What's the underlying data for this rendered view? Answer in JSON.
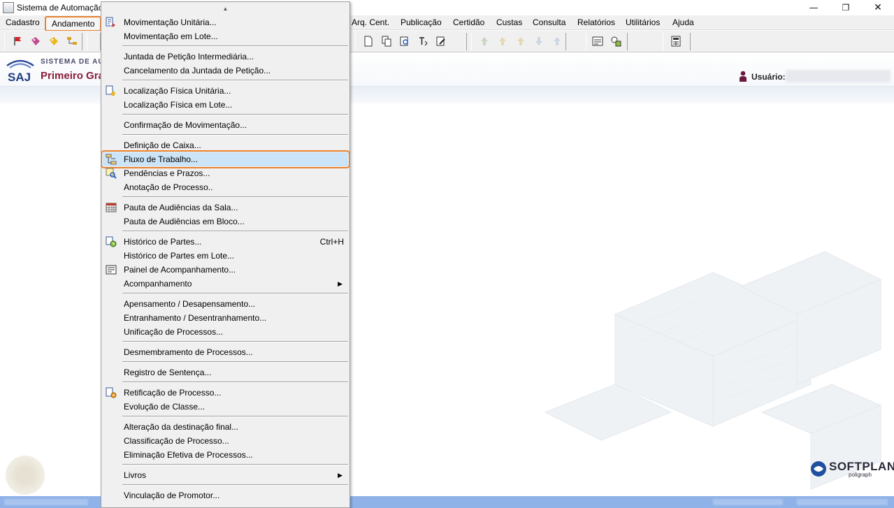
{
  "window": {
    "title": "Sistema de Automação",
    "minimize_glyph": "—",
    "maximize_glyph": "❐",
    "close_glyph": "✕"
  },
  "menubar": {
    "items": [
      "Cadastro",
      "Andamento",
      "Arq. Cent.",
      "Publicação",
      "Certidão",
      "Custas",
      "Consulta",
      "Relatórios",
      "Utilitários",
      "Ajuda"
    ],
    "active": "Andamento"
  },
  "header": {
    "logo_text": "SAJ",
    "system_name": "SISTEMA DE AUT",
    "degree": "Primeiro Gra",
    "user_label": "Usuário:"
  },
  "dropdown": {
    "scroll_up_glyph": "▲",
    "groups": [
      [
        {
          "label": "Movimentação Unitária...",
          "icon": "movement-icon"
        },
        {
          "label": "Movimentação em Lote..."
        }
      ],
      [
        {
          "label": "Juntada de Petição Intermediária..."
        },
        {
          "label": "Cancelamento da Juntada de Petição..."
        }
      ],
      [
        {
          "label": "Localização Física Unitária...",
          "icon": "location-icon"
        },
        {
          "label": "Localização Física em Lote..."
        }
      ],
      [
        {
          "label": "Confirmação de Movimentação..."
        }
      ],
      [
        {
          "label": "Definição de Caixa..."
        },
        {
          "label": "Fluxo de Trabalho...",
          "icon": "workflow-icon",
          "highlighted": true
        },
        {
          "label": "Pendências e Prazos...",
          "icon": "pending-search-icon"
        },
        {
          "label": "Anotação de Processo.."
        }
      ],
      [
        {
          "label": "Pauta de Audiências da Sala...",
          "icon": "calendar-icon"
        },
        {
          "label": "Pauta de Audiências em Bloco..."
        }
      ],
      [
        {
          "label": "Histórico de Partes...",
          "icon": "history-icon",
          "shortcut": "Ctrl+H"
        },
        {
          "label": "Histórico de Partes em Lote..."
        },
        {
          "label": "Painel de Acompanhamento...",
          "icon": "panel-icon"
        },
        {
          "label": "Acompanhamento",
          "submenu": true
        }
      ],
      [
        {
          "label": "Apensamento / Desapensamento..."
        },
        {
          "label": "Entranhamento / Desentranhamento..."
        },
        {
          "label": "Unificação de Processos..."
        }
      ],
      [
        {
          "label": "Desmembramento de Processos..."
        }
      ],
      [
        {
          "label": "Registro de Sentença..."
        }
      ],
      [
        {
          "label": "Retificação de Processo...",
          "icon": "rectify-icon"
        },
        {
          "label": "Evolução de Classe..."
        }
      ],
      [
        {
          "label": "Alteração da destinação final..."
        },
        {
          "label": "Classificação de Processo..."
        },
        {
          "label": "Eliminação Efetiva de Processos..."
        }
      ],
      [
        {
          "label": "Livros",
          "submenu": true
        }
      ],
      [
        {
          "label": "Vinculação de Promotor..."
        }
      ]
    ],
    "submenu_glyph": "▶"
  },
  "branding": {
    "name": "SOFTPLAN",
    "sub": "poligraph"
  },
  "colors": {
    "highlight_fill": "#cce4f7",
    "highlight_outline": "#e8822f",
    "status_bar": "#8fb2e8",
    "degree_text": "#8a1c3a"
  }
}
